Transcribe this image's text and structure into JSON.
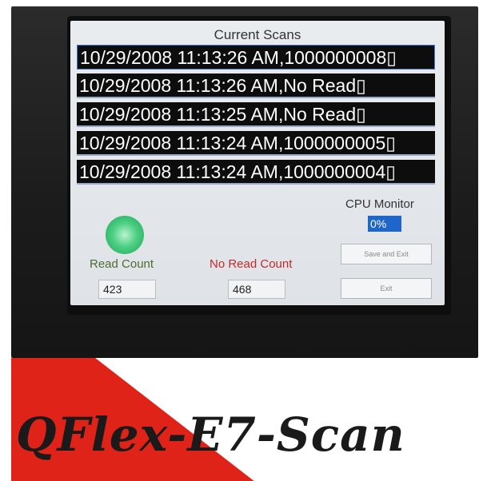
{
  "screen": {
    "title": "Current Scans",
    "scans": [
      "10/29/2008 11:13:26 AM,1000000008▯",
      "10/29/2008 11:13:26 AM,No Read▯",
      "10/29/2008 11:13:25 AM,No Read▯",
      "10/29/2008 11:13:24 AM,1000000005▯",
      "10/29/2008 11:13:24 AM,1000000004▯"
    ],
    "cpu_monitor_label": "CPU Monitor",
    "cpu_value": "0%",
    "read_count_label": "Read Count",
    "read_count_value": "423",
    "no_read_count_label": "No Read Count",
    "no_read_count_value": "468",
    "save_exit_label": "Save and Exit",
    "exit_label": "Exit"
  },
  "branding": {
    "logo": "QFlex-E7-Scan"
  },
  "colors": {
    "status_led": "#4ccf82",
    "no_read_label": "#c62828",
    "cpu_bar": "#1f66c9",
    "banner_red": "#e02318"
  }
}
